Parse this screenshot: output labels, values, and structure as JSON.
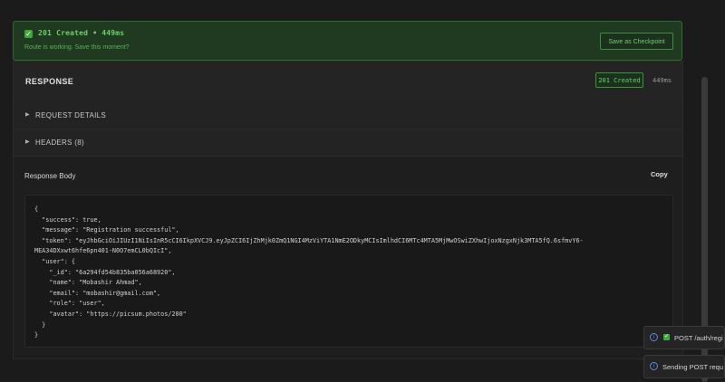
{
  "banner": {
    "title": "201 Created • 449ms",
    "subtitle": "Route is working. Save this moment?",
    "save_label": "Save as Checkpoint",
    "accent": "#6ad06a"
  },
  "response": {
    "heading": "RESPONSE",
    "status": "201 Created",
    "time": "449ms",
    "sections": [
      {
        "label": "REQUEST DETAILS"
      },
      {
        "label": "HEADERS (8)"
      }
    ],
    "body_label": "Response Body",
    "copy_label": "Copy",
    "body": "{\n  \"success\": true,\n  \"message\": \"Registration successful\",\n  \"token\": \"eyJhbGciOiJIUzI1NiIsInR5cCI6IkpXVCJ9.eyJpZCI6IjZhMjk0ZmQ1NGI4MzViYTA1NmE2ODkyMCIsImlhdCI6MTc4MTA5MjMwOSwiZXhwIjoxNzgxNjk3MTA5fQ.6sfmvY6-\nMEA34DXxwt6hfe6pn401-N0O7emCL0bQIcI\",\n  \"user\": {\n    \"_id\": \"6a294fd54b835ba056a68920\",\n    \"name\": \"Mobashir Ahmad\",\n    \"email\": \"mobashir@gmail.com\",\n    \"role\": \"user\",\n    \"avatar\": \"https://picsum.photos/200\"\n  }\n}"
  },
  "toasts": [
    {
      "text": "POST /auth/regi",
      "icon": "info-icon"
    },
    {
      "text": "Sending POST requ",
      "icon": "info-icon"
    }
  ]
}
